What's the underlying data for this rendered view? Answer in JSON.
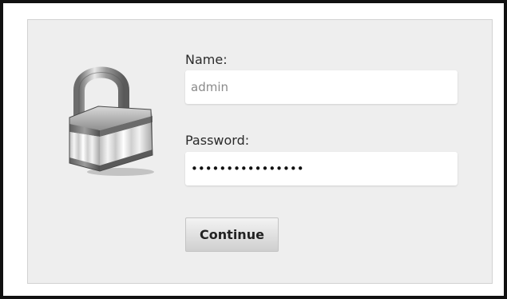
{
  "login": {
    "name_label": "Name:",
    "name_value": "admin",
    "password_label": "Password:",
    "password_value": "••••••••••••••••",
    "continue_label": "Continue"
  },
  "icons": {
    "lock": "padlock-icon"
  },
  "colors": {
    "panel_background": "#eeeeee",
    "frame_border": "#111111",
    "button_gradient_top": "#f3f3f3",
    "button_gradient_bottom": "#cfcfcf"
  }
}
